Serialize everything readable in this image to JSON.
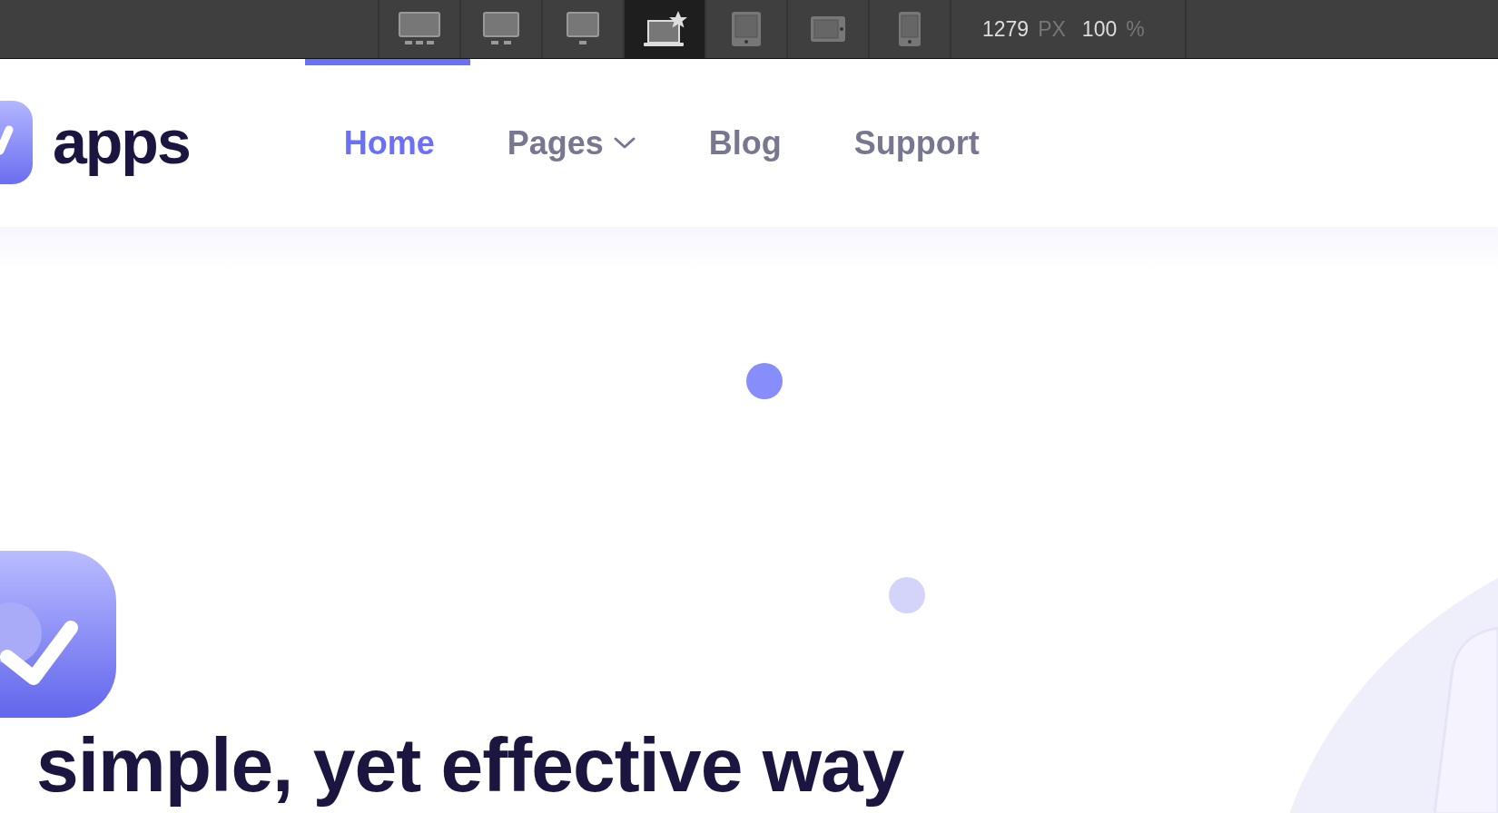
{
  "toolbar": {
    "devices": [
      {
        "kind": "desktop-large",
        "selected": false
      },
      {
        "kind": "desktop",
        "selected": false
      },
      {
        "kind": "desktop-small",
        "selected": false
      },
      {
        "kind": "laptop-base",
        "selected": true
      },
      {
        "kind": "tablet",
        "selected": false
      },
      {
        "kind": "tablet-landscape",
        "selected": false
      },
      {
        "kind": "phone",
        "selected": false
      }
    ],
    "width_value": "1279",
    "width_unit": "PX",
    "zoom_value": "100",
    "zoom_unit": "%"
  },
  "header": {
    "logo_text": "apps",
    "nav": [
      {
        "label": "Home",
        "selected": true,
        "dropdown": false
      },
      {
        "label": "Pages",
        "selected": false,
        "dropdown": true
      },
      {
        "label": "Blog",
        "selected": false,
        "dropdown": false
      },
      {
        "label": "Support",
        "selected": false,
        "dropdown": false
      }
    ]
  },
  "hero": {
    "heading": "simple, yet effective way"
  }
}
